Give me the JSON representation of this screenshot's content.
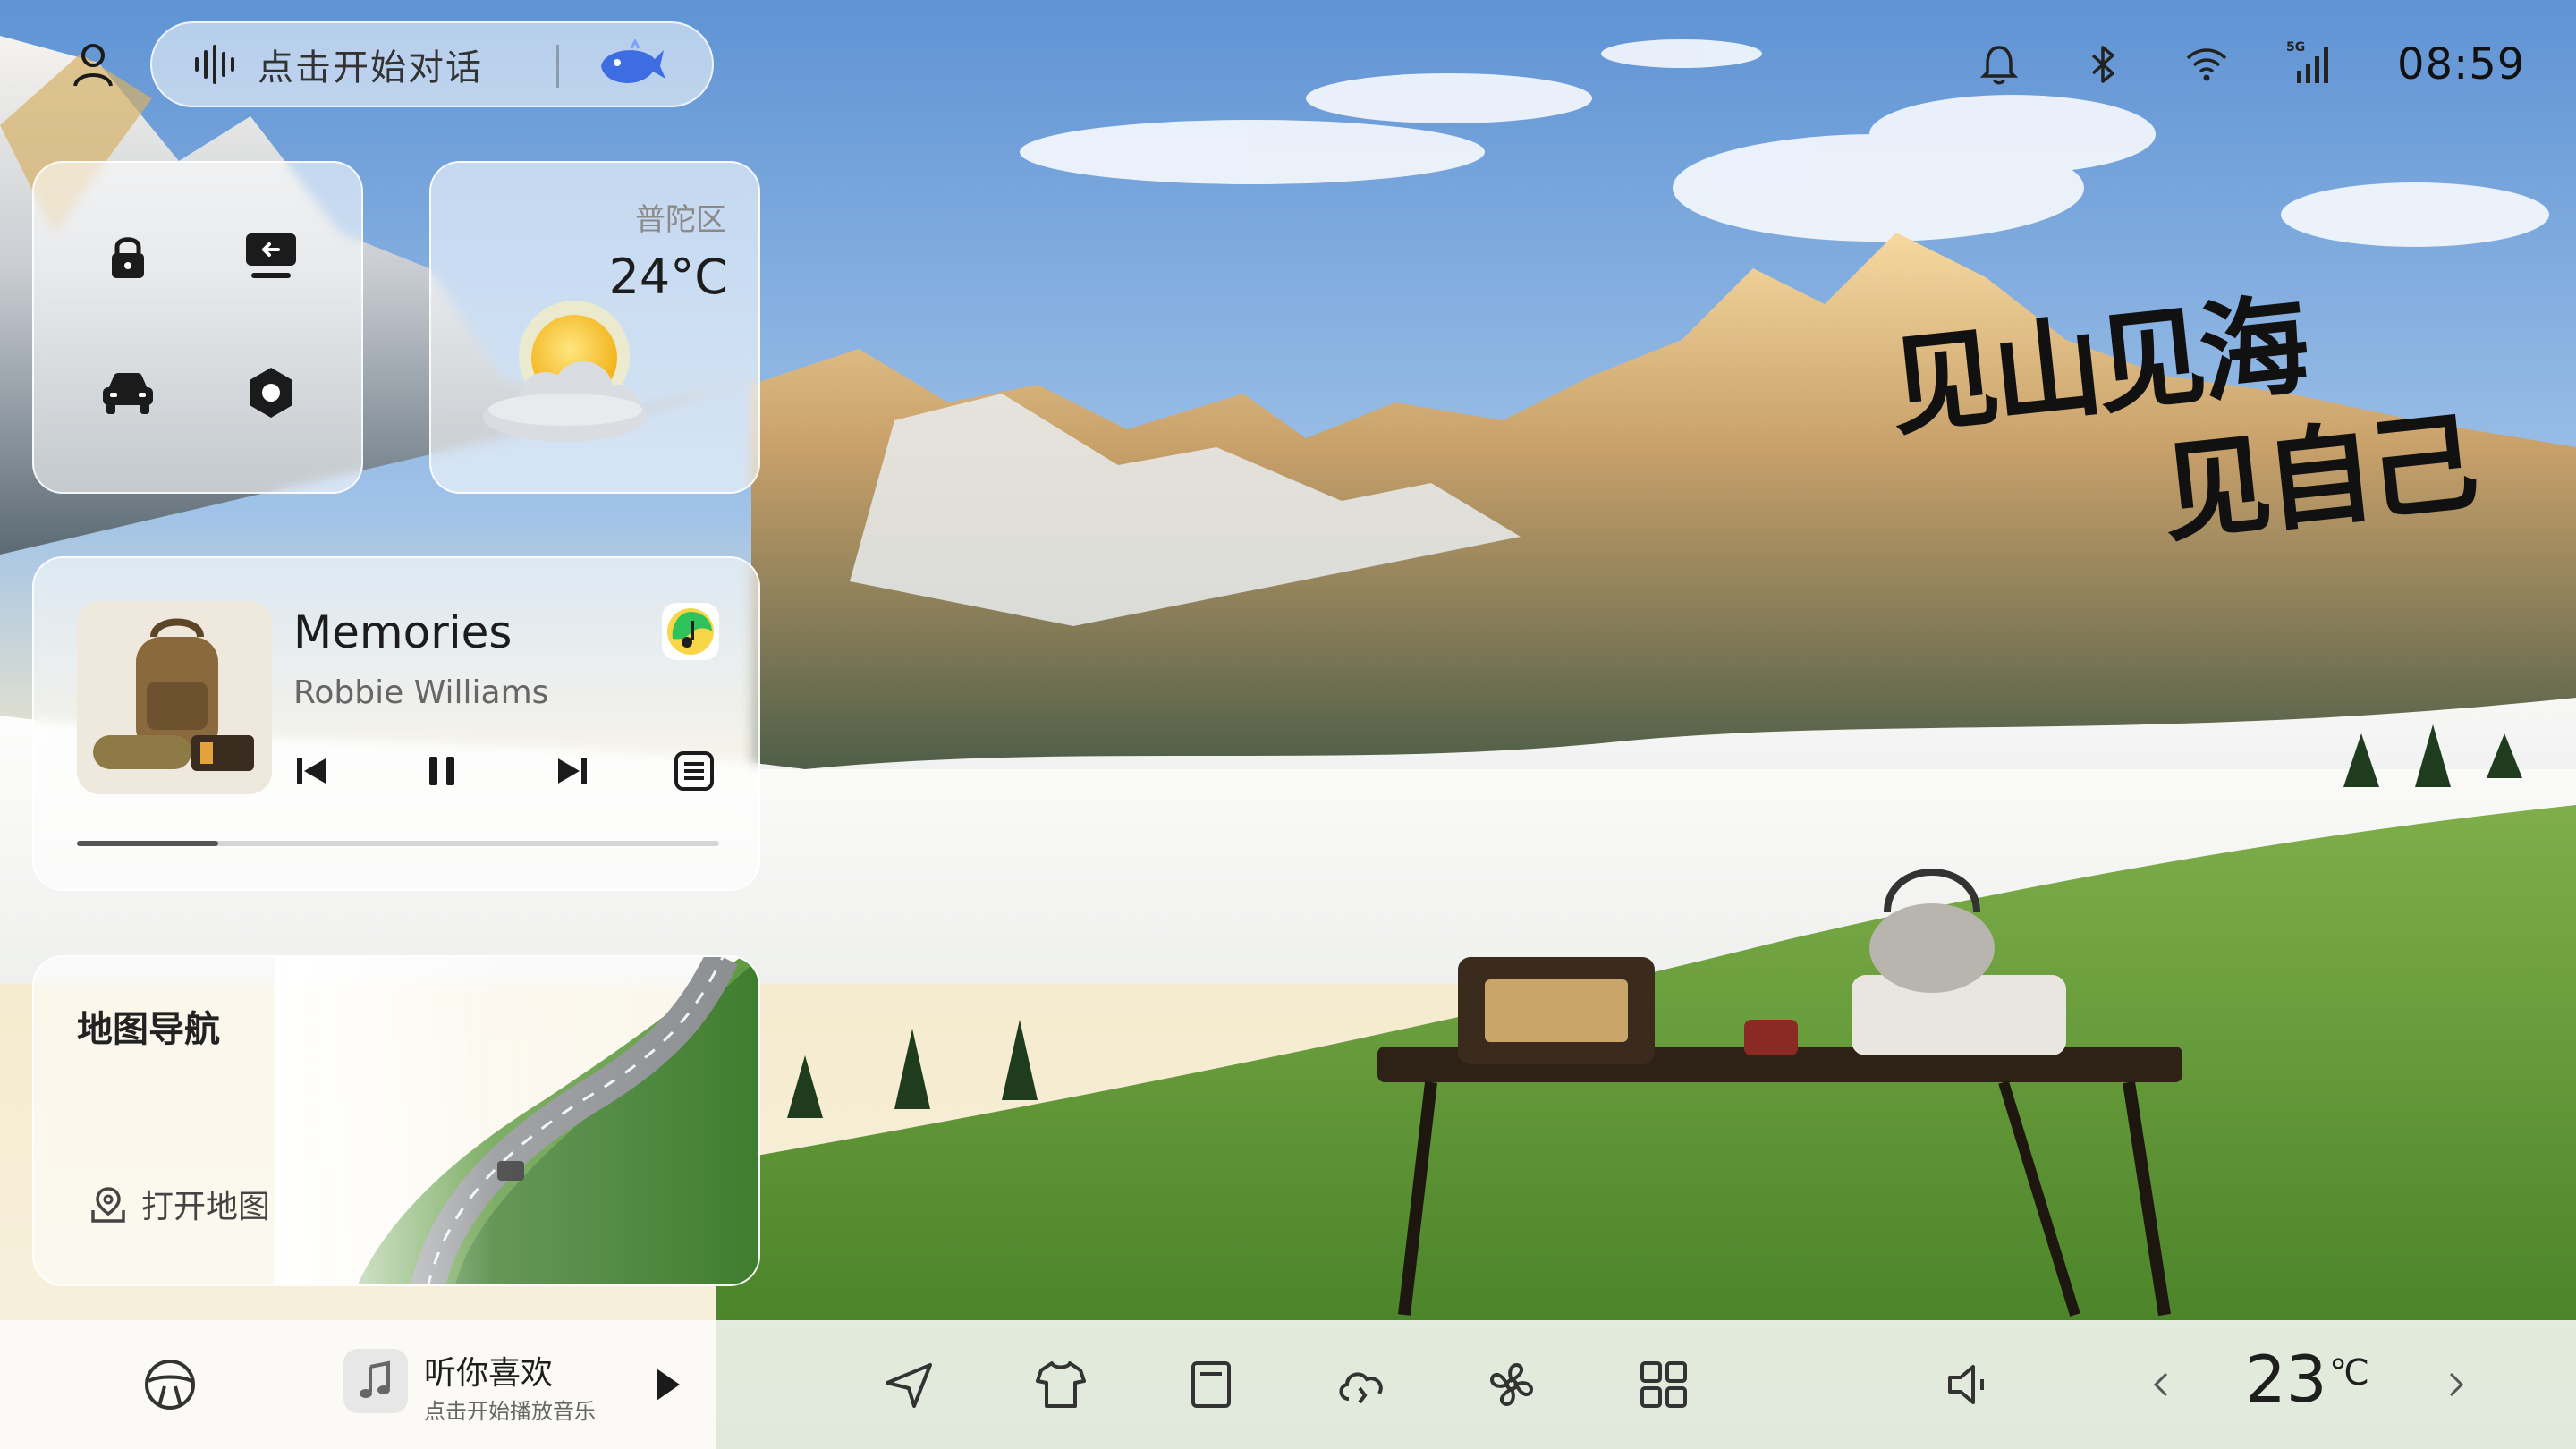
{
  "status_bar": {
    "voice_prompt": "点击开始对话",
    "clock": "08:59",
    "signal_label": "5G"
  },
  "wallpaper": {
    "slogan_line1": "见山见海",
    "slogan_line2": "见自己"
  },
  "weather": {
    "district": "普陀区",
    "temperature": "24°C",
    "condition_icon": "sun-behind-cloud-icon"
  },
  "quick_controls": [
    {
      "name": "lock-icon"
    },
    {
      "name": "screen-return-icon"
    },
    {
      "name": "car-icon"
    },
    {
      "name": "settings-hexagon-icon"
    }
  ],
  "music": {
    "title": "Memories",
    "artist": "Robbie Williams",
    "state": "playing",
    "progress": 0.22,
    "app_color": "#2fc25a"
  },
  "map_card": {
    "title": "地图导航",
    "open_label": "打开地图"
  },
  "dock": {
    "mini_player_title": "听你喜欢",
    "mini_player_subtitle": "点击开始播放音乐",
    "climate_temp": "23",
    "climate_unit": "℃",
    "items": [
      "steering-wheel-icon",
      "music-note-icon",
      "play-icon",
      "navigation-arrow-icon",
      "tshirt-icon",
      "document-icon",
      "cloud-icon",
      "fan-icon",
      "apps-grid-icon",
      "volume-icon",
      "chevron-left-icon",
      "chevron-right-icon"
    ]
  },
  "colors": {
    "accent": "#3d6de0",
    "card_bg": "#ffffffaa"
  }
}
